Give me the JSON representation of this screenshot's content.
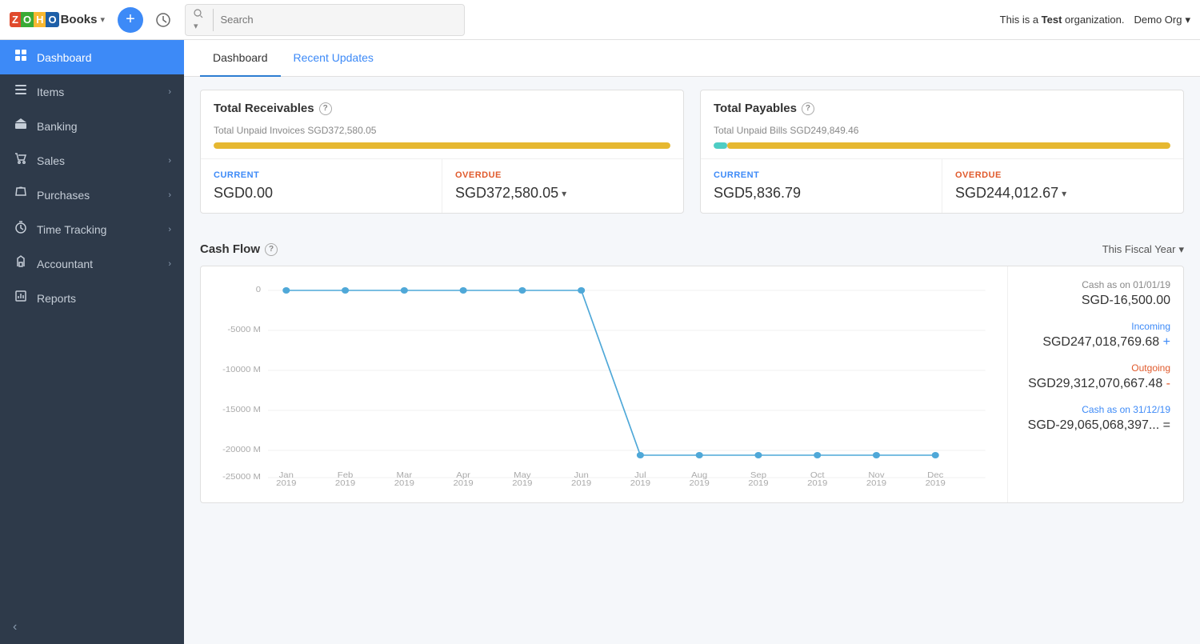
{
  "app": {
    "name": "Books",
    "chevron": "▾"
  },
  "topnav": {
    "search_placeholder": "Search",
    "search_filter": "▾",
    "org_message": "This is a ",
    "org_bold": "Test",
    "org_message2": " organization.",
    "org_name": "Demo Org",
    "org_chevron": "▾"
  },
  "sidebar": {
    "items": [
      {
        "id": "dashboard",
        "icon": "⊞",
        "label": "Dashboard",
        "active": true,
        "arrow": ""
      },
      {
        "id": "items",
        "icon": "☰",
        "label": "Items",
        "active": false,
        "arrow": "›"
      },
      {
        "id": "banking",
        "icon": "🏦",
        "label": "Banking",
        "active": false,
        "arrow": ""
      },
      {
        "id": "sales",
        "icon": "🛒",
        "label": "Sales",
        "active": false,
        "arrow": "›"
      },
      {
        "id": "purchases",
        "icon": "🛍",
        "label": "Purchases",
        "active": false,
        "arrow": "›"
      },
      {
        "id": "time-tracking",
        "icon": "⏱",
        "label": "Time Tracking",
        "active": false,
        "arrow": "›"
      },
      {
        "id": "accountant",
        "icon": "✎",
        "label": "Accountant",
        "active": false,
        "arrow": "›"
      },
      {
        "id": "reports",
        "icon": "📊",
        "label": "Reports",
        "active": false,
        "arrow": ""
      }
    ],
    "collapse_label": "‹"
  },
  "tabs": [
    {
      "id": "dashboard",
      "label": "Dashboard",
      "active": true
    },
    {
      "id": "recent-updates",
      "label": "Recent Updates",
      "active": false,
      "blue": true
    }
  ],
  "receivables": {
    "title": "Total Receivables",
    "subtitle": "Total Unpaid Invoices SGD372,580.05",
    "current_label": "CURRENT",
    "current_value": "SGD0.00",
    "overdue_label": "OVERDUE",
    "overdue_value": "SGD372,580.05",
    "overdue_arrow": "▾",
    "progress_pct": 100
  },
  "payables": {
    "title": "Total Payables",
    "subtitle": "Total Unpaid Bills SGD249,849.46",
    "current_label": "CURRENT",
    "current_value": "SGD5,836.79",
    "overdue_label": "OVERDUE",
    "overdue_value": "SGD244,012.67",
    "overdue_arrow": "▾",
    "progress_teal_pct": 3,
    "progress_yellow_pct": 97
  },
  "cashflow": {
    "title": "Cash Flow",
    "fiscal_year_label": "This Fiscal Year",
    "fiscal_year_arrow": "▾",
    "opening_label": "Cash as on 01/01/19",
    "opening_value": "SGD-16,500.00",
    "incoming_label": "Incoming",
    "incoming_value": "SGD247,018,769.68",
    "incoming_symbol": "+",
    "outgoing_label": "Outgoing",
    "outgoing_value": "SGD29,312,070,667.48",
    "outgoing_symbol": "-",
    "closing_label": "Cash as on 31/12/19",
    "closing_value": "SGD-29,065,068,397...",
    "closing_symbol": "=",
    "months": [
      "Jan\n2019",
      "Feb\n2019",
      "Mar\n2019",
      "Apr\n2019",
      "May\n2019",
      "Jun\n2019",
      "Jul\n2019",
      "Aug\n2019",
      "Sep\n2019",
      "Oct\n2019",
      "Nov\n2019",
      "Dec\n2019"
    ],
    "y_labels": [
      "0",
      "-5000 M",
      "-10000 M",
      "-15000 M",
      "-20000 M",
      "-25000 M"
    ],
    "chart_data": [
      0,
      0,
      0,
      0,
      0,
      0,
      -100,
      -100,
      -100,
      -100,
      -100,
      -100
    ]
  }
}
